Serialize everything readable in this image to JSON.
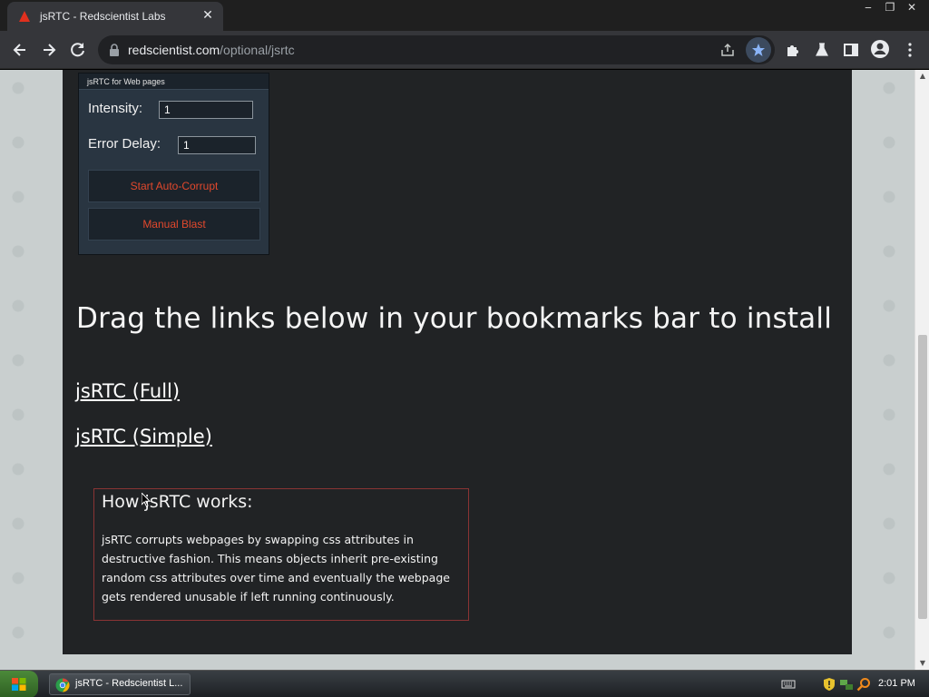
{
  "browser": {
    "tab_title": "jsRTC - Redscientist Labs",
    "url_domain": "redscientist.com",
    "url_path": "/optional/jsrtc"
  },
  "page": {
    "panel": {
      "title": "jsRTC for Web pages",
      "intensity_label": "Intensity:",
      "intensity_value": "1",
      "error_delay_label": "Error Delay:",
      "error_delay_value": "1",
      "start_button": "Start Auto-Corrupt",
      "blast_button": "Manual Blast"
    },
    "heading": "Drag the links below in your bookmarks bar to install",
    "links": {
      "full": "jsRTC (Full)",
      "simple": "jsRTC (Simple)"
    },
    "how": {
      "title": "How jsRTC works:",
      "body": "jsRTC corrupts webpages by swapping css attributes in destructive fashion. This means objects inherit pre-existing random css attributes over time and eventually the webpage gets rendered unusable if left running continuously."
    }
  },
  "taskbar": {
    "task_label": "jsRTC - Redscientist L...",
    "clock": "2:01 PM"
  },
  "colors": {
    "accent_red": "#e2482c",
    "panel_bg": "#293541",
    "content_bg": "#212325",
    "bookmark_star": "#8ab4f8"
  },
  "icons": [
    "redscientist-favicon",
    "close-icon",
    "back-icon",
    "forward-icon",
    "reload-icon",
    "lock-icon",
    "share-icon",
    "star-icon",
    "extensions-icon",
    "labs-icon",
    "side-panel-icon",
    "profile-icon",
    "menu-icon",
    "windows-start-icon",
    "chrome-icon",
    "keyboard-icon",
    "shield-icon",
    "network-icon",
    "search-icon"
  ]
}
